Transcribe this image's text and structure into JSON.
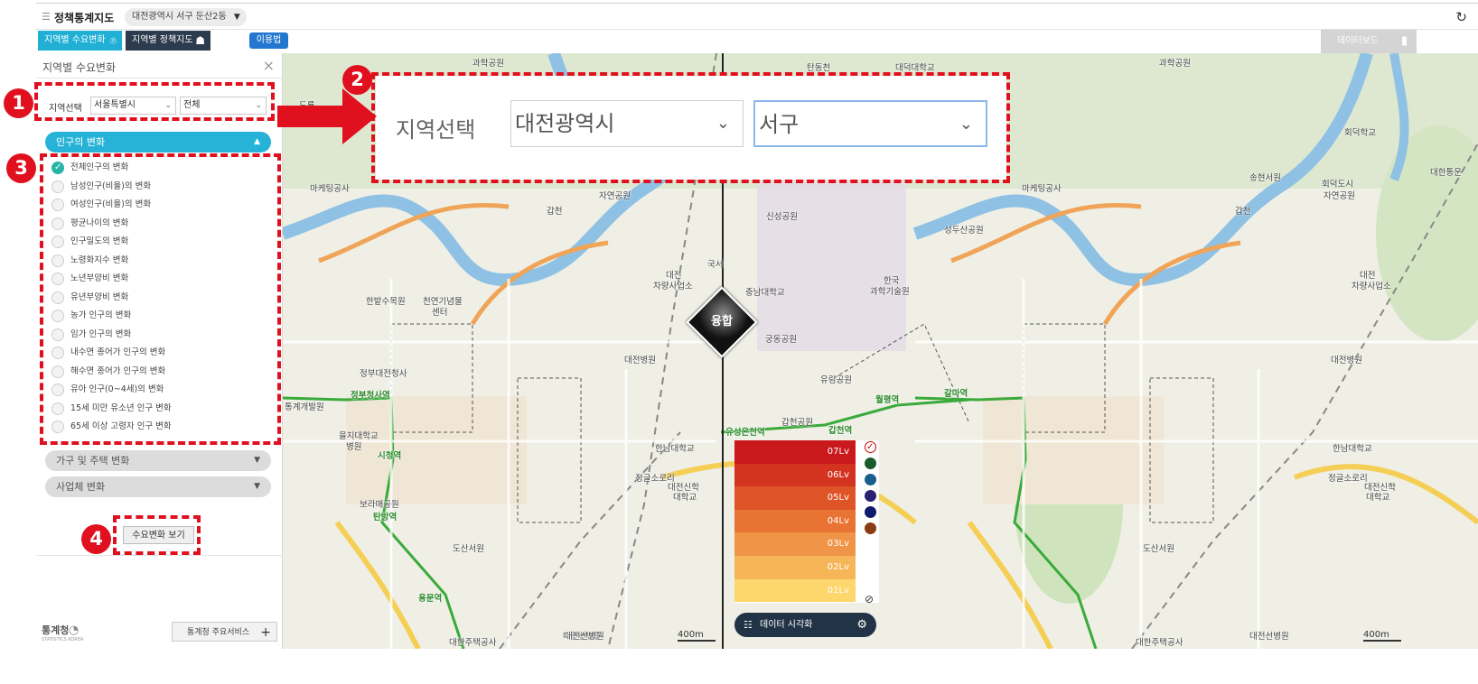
{
  "topbar": {
    "title": "정책통계지도",
    "location": "대전광역시 서구 둔산2동"
  },
  "tabs": [
    {
      "label": "지역별 수요변화"
    },
    {
      "label": "지역별 정책지도"
    }
  ],
  "usage_label": "이용법",
  "dashboard_label": "데이터보드",
  "panel": {
    "title": "지역별 수요변화",
    "region_label": "지역선택",
    "region_city": "서울특별시",
    "region_district": "전체",
    "category_population": "인구의 변화",
    "checklist": [
      {
        "label": "전체인구의 변화",
        "checked": true
      },
      {
        "label": "남성인구(비율)의 변화",
        "checked": false
      },
      {
        "label": "여성인구(비율)의 변화",
        "checked": false
      },
      {
        "label": "평균나이의 변화",
        "checked": false
      },
      {
        "label": "인구밀도의 변화",
        "checked": false
      },
      {
        "label": "노령화지수 변화",
        "checked": false
      },
      {
        "label": "노년부양비 변화",
        "checked": false
      },
      {
        "label": "유년부양비 변화",
        "checked": false
      },
      {
        "label": "농가 인구의 변화",
        "checked": false
      },
      {
        "label": "임가 인구의 변화",
        "checked": false
      },
      {
        "label": "내수면 종어가 인구의 변화",
        "checked": false
      },
      {
        "label": "해수면 종어가 인구의 변화",
        "checked": false
      },
      {
        "label": "유아 인구(0~4세)의 변화",
        "checked": false
      },
      {
        "label": "15세 미만 유소년 인구 변화",
        "checked": false
      },
      {
        "label": "65세 이상 고령자 인구 변화",
        "checked": false
      }
    ],
    "category_household": "가구 및 주택 변화",
    "category_business": "사업체 변화",
    "view_button": "수요변화 보기",
    "logo_text": "통계청",
    "logo_sub": "STATISTICS KOREA",
    "service_button": "통계청 주요서비스"
  },
  "callout": {
    "label": "지역선택",
    "city": "대전광역시",
    "district": "서구"
  },
  "annotations": [
    "1",
    "2",
    "3",
    "4"
  ],
  "map": {
    "labels_left": [
      {
        "text": "과학공원"
      },
      {
        "text": "마케팅공사"
      },
      {
        "text": "자연공원"
      },
      {
        "text": "갑천"
      },
      {
        "text": "한밭수목원"
      },
      {
        "text": "천연기념물"
      },
      {
        "text": "센터"
      },
      {
        "text": "정부대전청사"
      },
      {
        "text": "통계개발원"
      },
      {
        "text": "을지대학교"
      },
      {
        "text": "병원"
      },
      {
        "text": "보라매공원"
      },
      {
        "text": "도산서원"
      },
      {
        "text": "대전선병원"
      },
      {
        "text": "대한주택공사"
      },
      {
        "text": "도룡"
      }
    ],
    "labels_center": [
      {
        "text": "탄동천"
      },
      {
        "text": "대덕대학교"
      },
      {
        "text": "신성공원"
      },
      {
        "text": "성두산공원"
      },
      {
        "text": "충남대학교"
      },
      {
        "text": "한국"
      },
      {
        "text": "과학기술원"
      },
      {
        "text": "궁동공원"
      },
      {
        "text": "대전"
      },
      {
        "text": "차량사업소"
      },
      {
        "text": "국서"
      },
      {
        "text": "대전병원"
      },
      {
        "text": "유림공원"
      },
      {
        "text": "갑천공원"
      },
      {
        "text": "한남대학교"
      },
      {
        "text": "정글소로리"
      },
      {
        "text": "대전신학"
      },
      {
        "text": "대학교"
      },
      {
        "text": "대전선병원"
      }
    ],
    "labels_right": [
      {
        "text": "과학공원"
      },
      {
        "text": "회덕학교"
      },
      {
        "text": "송현서원"
      },
      {
        "text": "회덕도시"
      },
      {
        "text": "자연공원"
      },
      {
        "text": "마케팅공사"
      },
      {
        "text": "갑천"
      },
      {
        "text": "대전"
      },
      {
        "text": "차량사업소"
      },
      {
        "text": "대전병원"
      },
      {
        "text": "한남대학교"
      },
      {
        "text": "정글소로리"
      },
      {
        "text": "대전신학"
      },
      {
        "text": "대학교"
      },
      {
        "text": "도산서원"
      },
      {
        "text": "대전선병원"
      },
      {
        "text": "대한주택공사"
      },
      {
        "text": "대한통운"
      }
    ],
    "stations": [
      {
        "text": "정부청사역"
      },
      {
        "text": "시청역"
      },
      {
        "text": "탄방역"
      },
      {
        "text": "용문역"
      },
      {
        "text": "유성온천역"
      },
      {
        "text": "갑천역"
      },
      {
        "text": "월평역"
      },
      {
        "text": "갈마역"
      }
    ],
    "scale": "400m",
    "fusion_label": "융합",
    "legend": [
      {
        "label": "07Lv",
        "color": "#c9191c"
      },
      {
        "label": "06Lv",
        "color": "#d4331f"
      },
      {
        "label": "05Lv",
        "color": "#df5426"
      },
      {
        "label": "04Lv",
        "color": "#e87333"
      },
      {
        "label": "03Lv",
        "color": "#f09447"
      },
      {
        "label": "02Lv",
        "color": "#f6b658"
      },
      {
        "label": "01Lv",
        "color": "#fdd76b"
      }
    ],
    "swatches": [
      "#c9191c",
      "#1a5c2a",
      "#1b5e8d",
      "#2b1f72",
      "#0e1d6b",
      "#8b3c13"
    ],
    "viz_button": "데이터 시각화"
  },
  "colors": {
    "accent_teal": "#20b0d6",
    "dark_tab": "#2c3b4d",
    "usage_blue": "#2377d0",
    "annotation_red": "#e0101e"
  }
}
